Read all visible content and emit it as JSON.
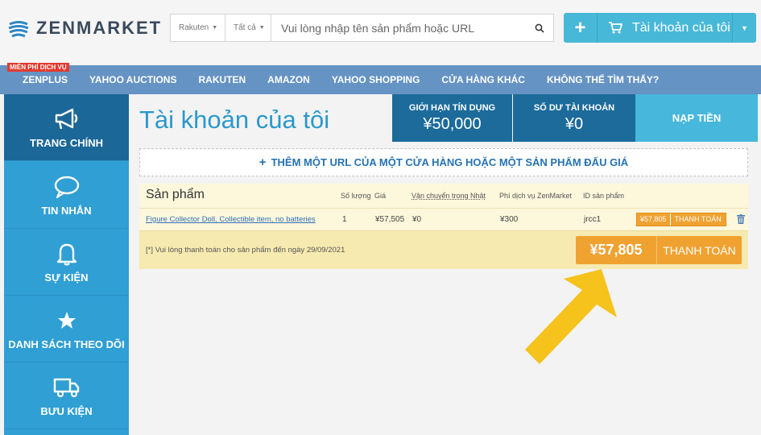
{
  "header": {
    "logo_text": "ZENMARKET",
    "search": {
      "store_select": "Rakuten",
      "category_select": "Tất cả",
      "placeholder": "Vui lòng nhập tên sản phẩm hoặc URL"
    },
    "account_button": "Tài khoản của tôi"
  },
  "nav": {
    "free_badge": "MIỄN PHÍ DỊCH VỤ",
    "items": [
      "ZENPLUS",
      "YAHOO AUCTIONS",
      "RAKUTEN",
      "AMAZON",
      "YAHOO SHOPPING",
      "CỬA HÀNG KHÁC",
      "KHÔNG THỂ TÌM THẤY?"
    ]
  },
  "sidebar": {
    "items": [
      "TRANG CHÍNH",
      "TIN NHẮN",
      "SỰ KIỆN",
      "DANH SÁCH THEO DÕI",
      "BƯU KIỆN"
    ]
  },
  "main": {
    "title": "Tài khoản của tôi",
    "credit_label": "GIỚI HẠN TÍN DỤNG",
    "credit_value": "¥50,000",
    "balance_label": "SỐ DƯ TÀI KHOẢN",
    "balance_value": "¥0",
    "topup_label": "NẠP TIỀN",
    "add_url_label": "THÊM MỘT URL CỦA MỘT CỬA HÀNG HOẶC MỘT SẢN PHẨM ĐẤU GIÁ"
  },
  "cart": {
    "title": "Sản phẩm",
    "columns": {
      "qty": "Số lượng",
      "price": "Giá",
      "shipping": "Vận chuyển trong Nhật",
      "fee": "Phí dịch vụ ZenMarket",
      "id": "ID sản phẩm"
    },
    "row": {
      "name": "Figure Collector Doll, Collectible item, no batteries",
      "qty": "1",
      "price": "¥57,505",
      "shipping": "¥0",
      "fee": "¥300",
      "id": "jrcc1",
      "pay_amount": "¥57,805",
      "pay_label": "THANH TOÁN"
    },
    "note": "[*] Vui lòng thanh toán cho sản phẩm đến ngày 29/09/2021",
    "total": "¥57,805",
    "pay_label": "THANH TOÁN"
  },
  "colors": {
    "brand_blue": "#2f9fd4",
    "dark_blue": "#1c6b9b",
    "nav_blue": "#6593c4",
    "accent_orange": "#f0a231",
    "arrow_yellow": "#f6c21c"
  }
}
